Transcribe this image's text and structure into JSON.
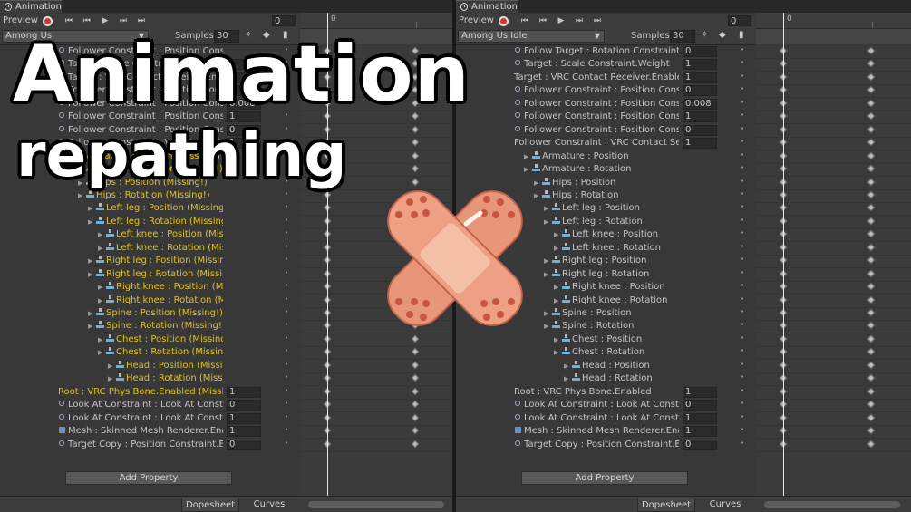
{
  "window": {
    "tab_title": "Animation"
  },
  "toolbar": {
    "preview_label": "Preview",
    "frame_value": "0",
    "samples_label": "Samples",
    "samples_value": "30"
  },
  "timeline": {
    "ruler_start": "0"
  },
  "thumbnail": {
    "title": "Animation",
    "subtitle": "repathing"
  },
  "colors": {
    "missing": "#e1c21a",
    "normal": "#c4c4c4",
    "panel": "#383838",
    "bandage": "#e8967a"
  },
  "left_panel": {
    "clip_name": "Among Us",
    "add_property_label": "Add Property",
    "bottom_tabs": [
      "Dopesheet",
      "Curves"
    ],
    "rows": [
      {
        "label": "Follower Constraint : Position Constrain",
        "value": "",
        "icon": "constraint-icon"
      },
      {
        "label": "Target : Scale Constraint.Weight",
        "value": "1",
        "icon": "constraint-icon"
      },
      {
        "label": "Target : VRC Contact Receiver.Enabled",
        "value": "1",
        "icon": "constraint-icon"
      },
      {
        "label": "Follower Constraint : Position Constrain",
        "value": "0",
        "icon": "constraint-icon"
      },
      {
        "label": "Follower Constraint : Position Constrain",
        "value": "0.008",
        "icon": "constraint-icon"
      },
      {
        "label": "Follower Constraint : Position Constrain",
        "value": "1",
        "icon": "constraint-icon"
      },
      {
        "label": "Follower Constraint : Position Constrain",
        "value": "0",
        "icon": "constraint-icon"
      },
      {
        "label": "Follower Constraint : VRC Contact Sender",
        "value": "1",
        "icon": "constraint-icon"
      },
      {
        "label": "Armature : Position (Missing!)",
        "value": "",
        "icon": "bone-icon"
      },
      {
        "label": "Armature : Rotation (Missing!)",
        "value": "",
        "icon": "bone-icon"
      },
      {
        "label": "Hips : Position (Missing!)",
        "value": "",
        "icon": "bone-icon"
      },
      {
        "label": "Hips : Rotation (Missing!)",
        "value": "",
        "icon": "bone-icon"
      },
      {
        "label": "Left leg : Position (Missing!)",
        "value": "",
        "icon": "bone-icon"
      },
      {
        "label": "Left leg : Rotation (Missing!)",
        "value": "",
        "icon": "bone-icon"
      },
      {
        "label": "Left knee : Position (Missing!)",
        "value": "",
        "icon": "bone-icon"
      },
      {
        "label": "Left knee : Rotation (Missing!)",
        "value": "",
        "icon": "bone-icon"
      },
      {
        "label": "Right leg : Position (Missing!)",
        "value": "",
        "icon": "bone-icon"
      },
      {
        "label": "Right leg : Rotation (Missing!)",
        "value": "",
        "icon": "bone-icon"
      },
      {
        "label": "Right knee : Position (Missing!)",
        "value": "",
        "icon": "bone-icon"
      },
      {
        "label": "Right knee : Rotation (Missing!)",
        "value": "",
        "icon": "bone-icon"
      },
      {
        "label": "Spine : Position (Missing!)",
        "value": "",
        "icon": "bone-icon"
      },
      {
        "label": "Spine : Rotation (Missing!)",
        "value": "",
        "icon": "bone-icon"
      },
      {
        "label": "Chest : Position (Missing!)",
        "value": "",
        "icon": "bone-icon"
      },
      {
        "label": "Chest : Rotation (Missing!)",
        "value": "",
        "icon": "bone-icon"
      },
      {
        "label": "Head : Position (Missing!)",
        "value": "",
        "icon": "bone-icon"
      },
      {
        "label": "Head : Rotation (Missing!)",
        "value": "",
        "icon": "bone-icon"
      },
      {
        "label": "Root : VRC Phys Bone.Enabled (Missi",
        "value": "1",
        "icon": "none"
      },
      {
        "label": "Look At Constraint : Look At Constrai",
        "value": "0",
        "icon": "constraint-icon"
      },
      {
        "label": "Look At Constraint : Look At Constrai",
        "value": "1",
        "icon": "constraint-icon"
      },
      {
        "label": "Mesh : Skinned Mesh Renderer.Enab",
        "value": "1",
        "icon": "mesh-icon"
      },
      {
        "label": "Target Copy : Position Constraint.Enabl",
        "value": "0",
        "icon": "constraint-icon"
      }
    ]
  },
  "right_panel": {
    "clip_name": "Among Us Idle",
    "add_property_label": "Add Property",
    "bottom_tabs": [
      "Dopesheet",
      "Curves"
    ],
    "rows": [
      {
        "label": "Follow Target : Rotation Constraint.Enal",
        "value": "0",
        "icon": "constraint-icon"
      },
      {
        "label": "Target : Scale Constraint.Weight",
        "value": "1",
        "icon": "constraint-icon"
      },
      {
        "label": "Target : VRC Contact Receiver.Enabled",
        "value": "1",
        "icon": "none"
      },
      {
        "label": "Follower Constraint : Position Constrain",
        "value": "0",
        "icon": "constraint-icon"
      },
      {
        "label": "Follower Constraint : Position Constrain",
        "value": "0.008",
        "icon": "constraint-icon"
      },
      {
        "label": "Follower Constraint : Position Constrain",
        "value": "1",
        "icon": "constraint-icon"
      },
      {
        "label": "Follower Constraint : Position Constrain",
        "value": "0",
        "icon": "constraint-icon"
      },
      {
        "label": "Follower Constraint : VRC Contact Sender",
        "value": "1",
        "icon": "none"
      },
      {
        "label": "Armature : Position",
        "value": "",
        "icon": "bone-icon"
      },
      {
        "label": "Armature : Rotation",
        "value": "",
        "icon": "bone-icon"
      },
      {
        "label": "Hips : Position",
        "value": "",
        "icon": "bone-icon"
      },
      {
        "label": "Hips : Rotation",
        "value": "",
        "icon": "bone-icon"
      },
      {
        "label": "Left leg : Position",
        "value": "",
        "icon": "bone-icon"
      },
      {
        "label": "Left leg : Rotation",
        "value": "",
        "icon": "bone-icon"
      },
      {
        "label": "Left knee : Position",
        "value": "",
        "icon": "bone-icon"
      },
      {
        "label": "Left knee : Rotation",
        "value": "",
        "icon": "bone-icon"
      },
      {
        "label": "Right leg : Position",
        "value": "",
        "icon": "bone-icon"
      },
      {
        "label": "Right leg : Rotation",
        "value": "",
        "icon": "bone-icon"
      },
      {
        "label": "Right knee : Position",
        "value": "",
        "icon": "bone-icon"
      },
      {
        "label": "Right knee : Rotation",
        "value": "",
        "icon": "bone-icon"
      },
      {
        "label": "Spine : Position",
        "value": "",
        "icon": "bone-icon"
      },
      {
        "label": "Spine : Rotation",
        "value": "",
        "icon": "bone-icon"
      },
      {
        "label": "Chest : Position",
        "value": "",
        "icon": "bone-icon"
      },
      {
        "label": "Chest : Rotation",
        "value": "",
        "icon": "bone-icon"
      },
      {
        "label": "Head : Position",
        "value": "",
        "icon": "bone-icon"
      },
      {
        "label": "Head : Rotation",
        "value": "",
        "icon": "bone-icon"
      },
      {
        "label": "Root : VRC Phys Bone.Enabled",
        "value": "1",
        "icon": "none"
      },
      {
        "label": "Look At Constraint : Look At Constrai",
        "value": "0",
        "icon": "constraint-icon"
      },
      {
        "label": "Look At Constraint : Look At Constrai",
        "value": "1",
        "icon": "constraint-icon"
      },
      {
        "label": "Mesh : Skinned Mesh Renderer.Enab",
        "value": "1",
        "icon": "mesh-icon"
      },
      {
        "label": "Target Copy : Position Constraint.Enabl",
        "value": "0",
        "icon": "constraint-icon"
      }
    ]
  }
}
